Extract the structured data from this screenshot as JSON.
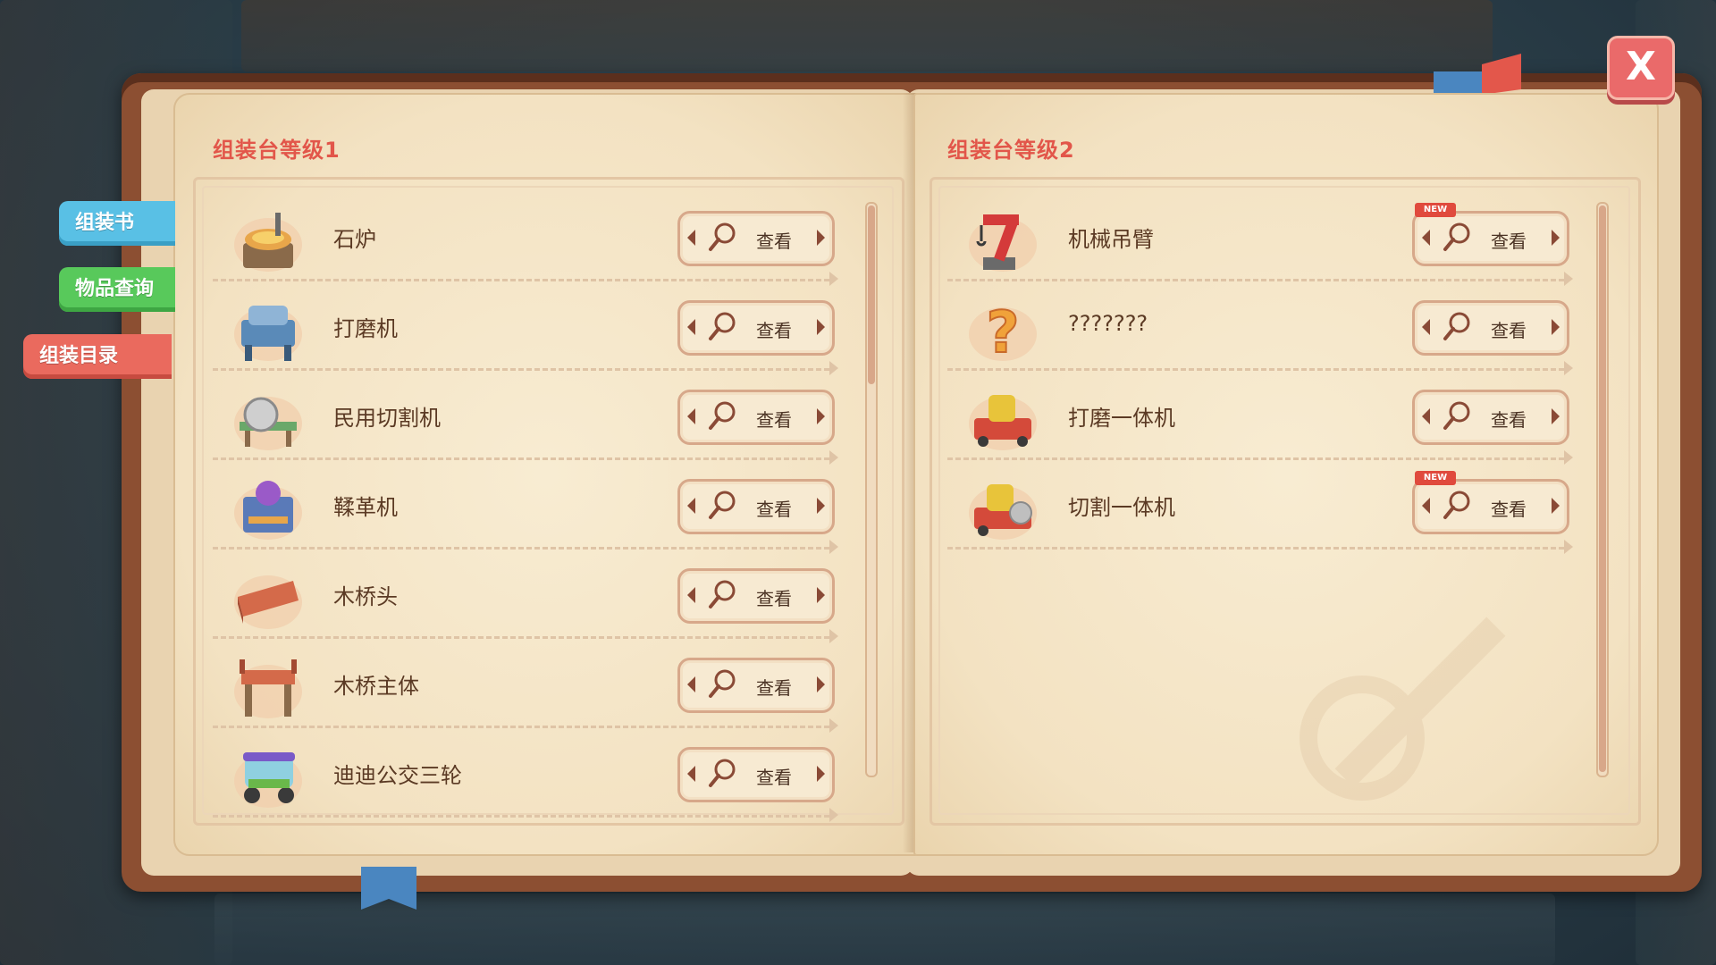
{
  "tabs": [
    {
      "label": "组装书",
      "color": "#59c0e5"
    },
    {
      "label": "物品查询",
      "color": "#58c95b"
    },
    {
      "label": "组装目录",
      "color": "#ea6a5e",
      "active": true
    }
  ],
  "close_button": {
    "label": "X"
  },
  "left_page": {
    "title": "组装台等级1",
    "items": [
      {
        "name": "石炉",
        "button": "查看",
        "icon": "stone-furnace-icon",
        "new": false
      },
      {
        "name": "打磨机",
        "button": "查看",
        "icon": "grinder-icon",
        "new": false
      },
      {
        "name": "民用切割机",
        "button": "查看",
        "icon": "civil-cutter-icon",
        "new": false
      },
      {
        "name": "鞣革机",
        "button": "查看",
        "icon": "tanning-machine-icon",
        "new": false
      },
      {
        "name": "木桥头",
        "button": "查看",
        "icon": "wooden-bridge-head-icon",
        "new": false
      },
      {
        "name": "木桥主体",
        "button": "查看",
        "icon": "wooden-bridge-body-icon",
        "new": false
      },
      {
        "name": "迪迪公交三轮",
        "button": "查看",
        "icon": "tricycle-icon",
        "new": false
      }
    ]
  },
  "right_page": {
    "title": "组装台等级2",
    "items": [
      {
        "name": "机械吊臂",
        "button": "查看",
        "icon": "mechanical-arm-icon",
        "new": true
      },
      {
        "name": "???????",
        "button": "查看",
        "icon": "unknown-question-icon",
        "new": false
      },
      {
        "name": "打磨一体机",
        "button": "查看",
        "icon": "integrated-grinder-icon",
        "new": false
      },
      {
        "name": "切割一体机",
        "button": "查看",
        "icon": "integrated-cutter-icon",
        "new": true
      }
    ]
  },
  "new_badge_text": "NEW"
}
